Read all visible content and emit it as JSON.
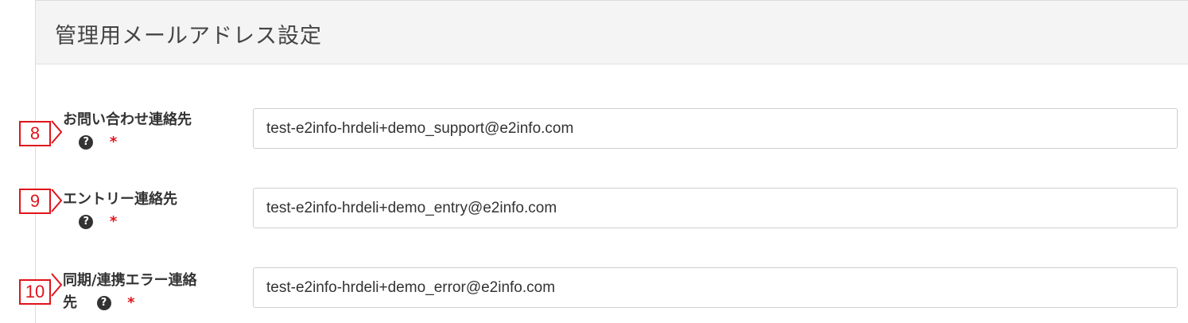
{
  "section": {
    "title": "管理用メールアドレス設定"
  },
  "fields": [
    {
      "marker": "8",
      "label": "お問い合わせ連絡先",
      "help_icon": "question-circle-icon",
      "required_mark": "*",
      "value": "test-e2info-hrdeli+demo_support@e2info.com"
    },
    {
      "marker": "9",
      "label": "エントリー連絡先",
      "help_icon": "question-circle-icon",
      "required_mark": "*",
      "value": "test-e2info-hrdeli+demo_entry@e2info.com"
    },
    {
      "marker": "10",
      "label_line1": "同期/連携エラー連絡",
      "label_line2": "先",
      "help_icon": "question-circle-icon",
      "required_mark": "*",
      "value": "test-e2info-hrdeli+demo_error@e2info.com"
    }
  ],
  "colors": {
    "marker_red": "#e0141b",
    "required_red": "#e0141b",
    "header_bg": "#f4f4f4",
    "text": "#333333"
  }
}
